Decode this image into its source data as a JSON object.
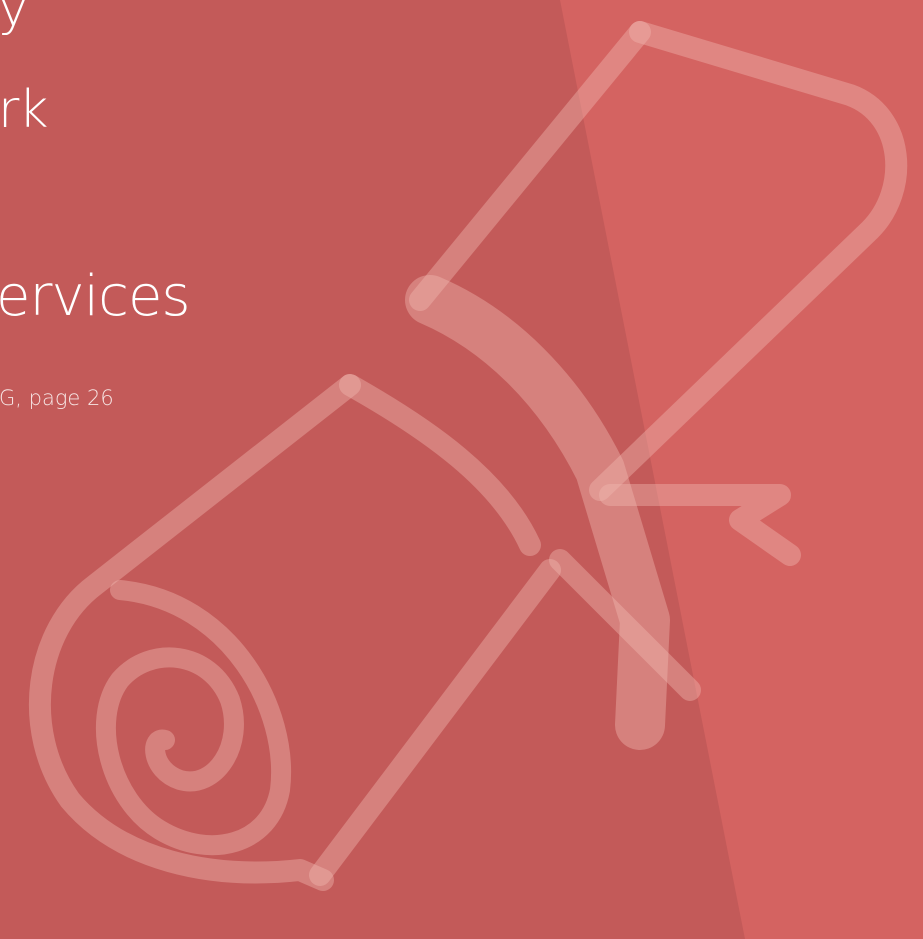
{
  "slide": {
    "title_line_1": "y",
    "title_line_2": "rk",
    "heading": "ervices",
    "source_text": "G, page 26"
  },
  "illustration": {
    "icon": "diploma-scroll-icon"
  },
  "colors": {
    "background_left": "#c35a59",
    "background_right": "#d46361",
    "watermark": "#f0b7b1"
  }
}
